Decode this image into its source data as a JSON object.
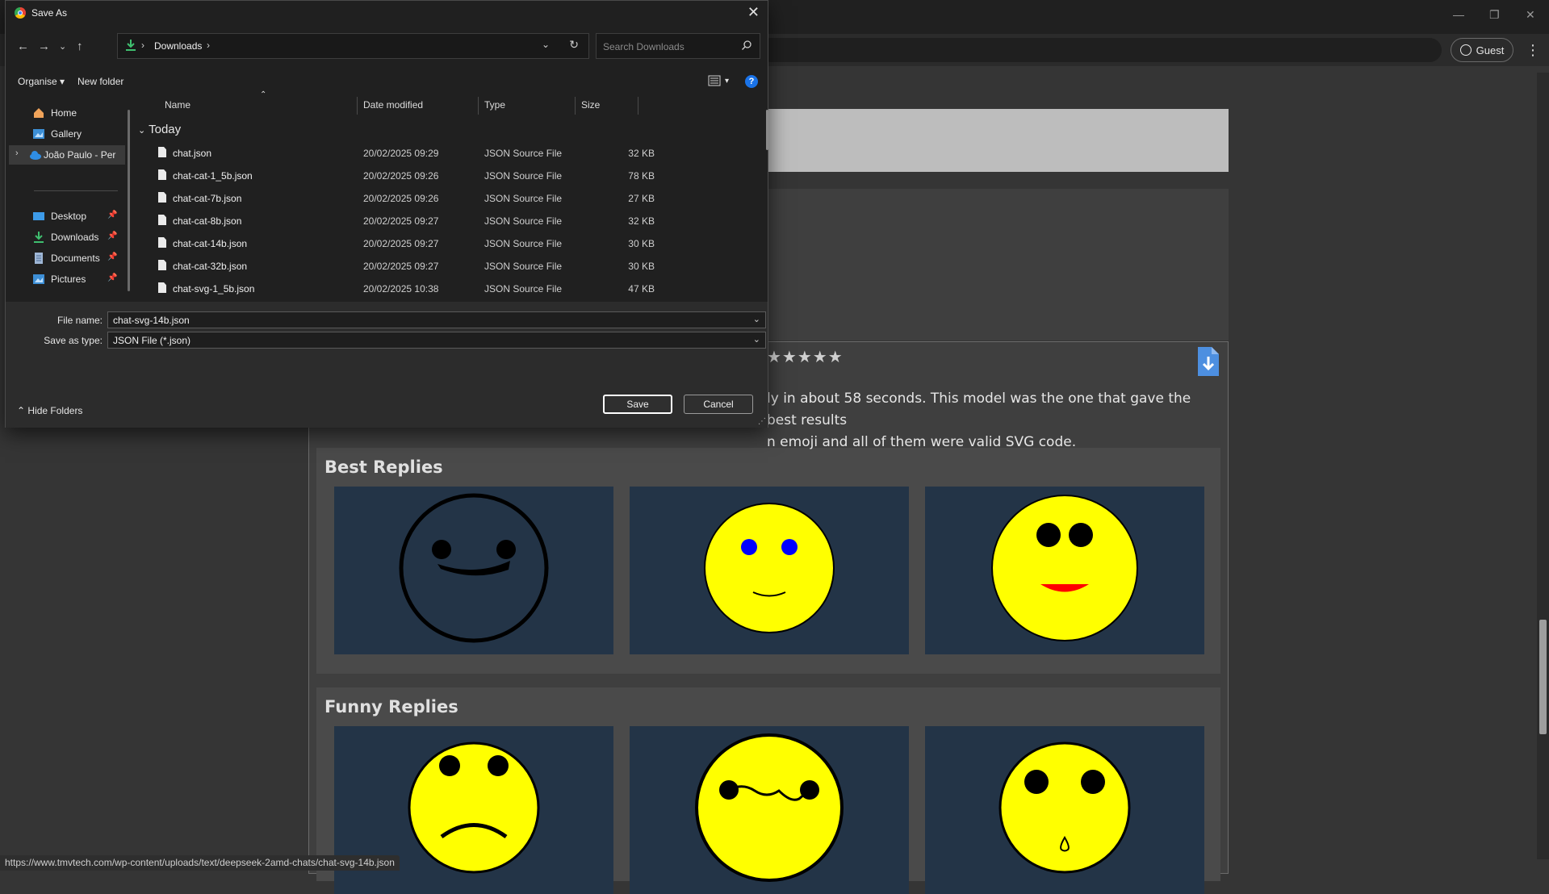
{
  "browser": {
    "guest_label": "Guest",
    "status_url": "https://www.tmvtech.com/wp-content/uploads/text/deepseek-2amd-chats/chat-svg-14b.json"
  },
  "page": {
    "rating": "★★★★★",
    "description": "ly in about 58 seconds. This model was the one that gave the best results n emoji and all of them were valid SVG code.",
    "description_line1": "ly in about 58 seconds. This model was the one that gave the best results",
    "description_line2": "n emoji and all of them were valid SVG code.",
    "best_title": "Best Replies",
    "funny_title": "Funny Replies"
  },
  "dialog": {
    "title": "Save As",
    "address": {
      "location": "Downloads"
    },
    "search_placeholder": "Search Downloads",
    "commands": {
      "organise": "Organise",
      "new_folder": "New folder"
    },
    "nav": {
      "items": [
        {
          "label": "Home",
          "icon": "home-icon"
        },
        {
          "label": "Gallery",
          "icon": "gallery-icon"
        },
        {
          "label": "João Paulo - Per",
          "icon": "onedrive-cloud-icon"
        },
        {
          "label": "Desktop",
          "icon": "desktop-icon"
        },
        {
          "label": "Downloads",
          "icon": "download-icon"
        },
        {
          "label": "Documents",
          "icon": "documents-icon"
        },
        {
          "label": "Pictures",
          "icon": "pictures-icon"
        }
      ]
    },
    "columns": {
      "name": "Name",
      "date": "Date modified",
      "type": "Type",
      "size": "Size"
    },
    "group": "Today",
    "files": [
      {
        "name": "chat.json",
        "date": "20/02/2025 09:29",
        "type": "JSON Source File",
        "size": "32 KB"
      },
      {
        "name": "chat-cat-1_5b.json",
        "date": "20/02/2025 09:26",
        "type": "JSON Source File",
        "size": "78 KB"
      },
      {
        "name": "chat-cat-7b.json",
        "date": "20/02/2025 09:26",
        "type": "JSON Source File",
        "size": "27 KB"
      },
      {
        "name": "chat-cat-8b.json",
        "date": "20/02/2025 09:27",
        "type": "JSON Source File",
        "size": "32 KB"
      },
      {
        "name": "chat-cat-14b.json",
        "date": "20/02/2025 09:27",
        "type": "JSON Source File",
        "size": "30 KB"
      },
      {
        "name": "chat-cat-32b.json",
        "date": "20/02/2025 09:27",
        "type": "JSON Source File",
        "size": "30 KB"
      },
      {
        "name": "chat-svg-1_5b.json",
        "date": "20/02/2025 10:38",
        "type": "JSON Source File",
        "size": "47 KB"
      }
    ],
    "file_name_label": "File name:",
    "file_name_value": "chat-svg-14b.json",
    "save_type_label": "Save as type:",
    "save_type_value": "JSON File (*.json)",
    "hide_folders": "Hide Folders",
    "save_button": "Save",
    "cancel_button": "Cancel"
  },
  "colors": {
    "tile_bg": "#233447",
    "emoji_yellow": "#ffff00",
    "help_blue": "#1a73e8"
  }
}
